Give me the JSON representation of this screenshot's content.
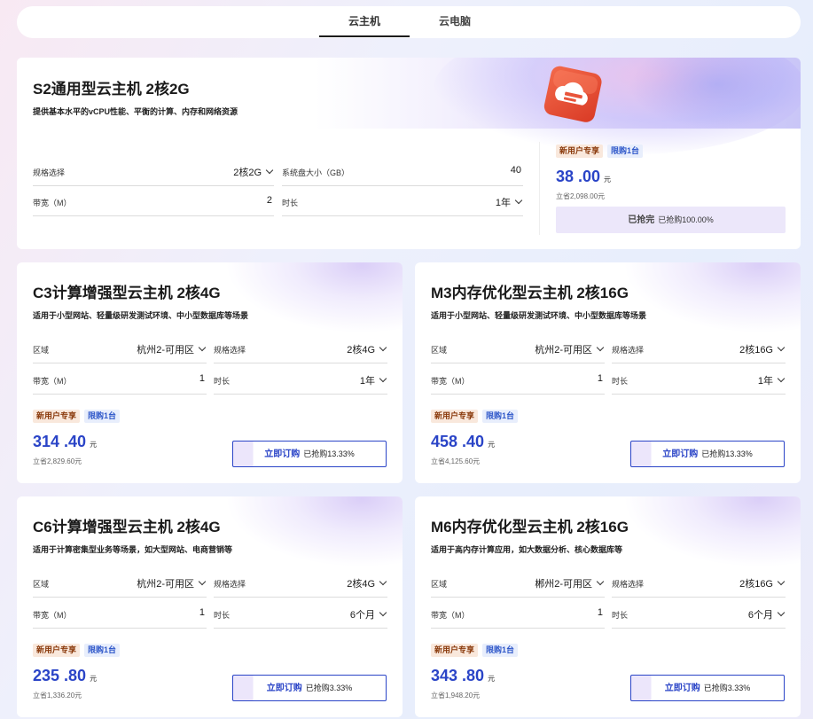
{
  "tabs": [
    {
      "label": "云主机"
    },
    {
      "label": "云电脑"
    }
  ],
  "featured": {
    "title": "S2通用型云主机 2核2G",
    "desc": "提供基本水平的vCPU性能、平衡的计算、内存和网络资源",
    "fields": {
      "spec_label": "规格选择",
      "spec_value": "2核2G",
      "disk_label": "系统盘大小（GB）",
      "disk_value": "40",
      "bw_label": "带宽（M）",
      "bw_value": "2",
      "dur_label": "时长",
      "dur_value": "1年"
    },
    "badge_new": "新用户专享",
    "badge_limit": "限购1台",
    "price": "38 .00",
    "unit": "元",
    "save": "立省2,098.00元",
    "soldout_label": "已抢完",
    "soldout_status": "已抢购100.00%"
  },
  "products": [
    {
      "title": "C3计算增强型云主机 2核4G",
      "desc": "适用于小型网站、轻量级研发测试环境、中小型数据库等场景",
      "region_label": "区域",
      "region_value": "杭州2-可用区",
      "spec_label": "规格选择",
      "spec_value": "2核4G",
      "bw_label": "带宽（M）",
      "bw_value": "1",
      "dur_label": "时长",
      "dur_value": "1年",
      "badge_new": "新用户专享",
      "badge_limit": "限购1台",
      "price": "314 .40",
      "unit": "元",
      "save": "立省2,829.60元",
      "buy_label": "立即订购",
      "buy_status": "已抢购13.33%"
    },
    {
      "title": "M3内存优化型云主机 2核16G",
      "desc": "适用于小型网站、轻量级研发测试环境、中小型数据库等场景",
      "region_label": "区域",
      "region_value": "杭州2-可用区",
      "spec_label": "规格选择",
      "spec_value": "2核16G",
      "bw_label": "带宽（M）",
      "bw_value": "1",
      "dur_label": "时长",
      "dur_value": "1年",
      "badge_new": "新用户专享",
      "badge_limit": "限购1台",
      "price": "458 .40",
      "unit": "元",
      "save": "立省4,125.60元",
      "buy_label": "立即订购",
      "buy_status": "已抢购13.33%"
    },
    {
      "title": "C6计算增强型云主机 2核4G",
      "desc": "适用于计算密集型业务等场景，如大型网站、电商营销等",
      "region_label": "区域",
      "region_value": "杭州2-可用区",
      "spec_label": "规格选择",
      "spec_value": "2核4G",
      "bw_label": "带宽（M）",
      "bw_value": "1",
      "dur_label": "时长",
      "dur_value": "6个月",
      "badge_new": "新用户专享",
      "badge_limit": "限购1台",
      "price": "235 .80",
      "unit": "元",
      "save": "立省1,336.20元",
      "buy_label": "立即订购",
      "buy_status": "已抢购3.33%"
    },
    {
      "title": "M6内存优化型云主机 2核16G",
      "desc": "适用于高内存计算应用，如大数据分析、核心数据库等",
      "region_label": "区域",
      "region_value": "郴州2-可用区",
      "spec_label": "规格选择",
      "spec_value": "2核16G",
      "bw_label": "带宽（M）",
      "bw_value": "1",
      "dur_label": "时长",
      "dur_value": "6个月",
      "badge_new": "新用户专享",
      "badge_limit": "限购1台",
      "price": "343 .80",
      "unit": "元",
      "save": "立省1,948.20元",
      "buy_label": "立即订购",
      "buy_status": "已抢购3.33%"
    }
  ],
  "colors": {
    "accent": "#2a44c7",
    "badge_new_bg": "#f9e8dc",
    "badge_limit_bg": "#e8eefc",
    "logo": "#e8543a"
  },
  "icons": {
    "logo": "cloud-server-icon",
    "dropdown": "chevron-down-icon"
  }
}
